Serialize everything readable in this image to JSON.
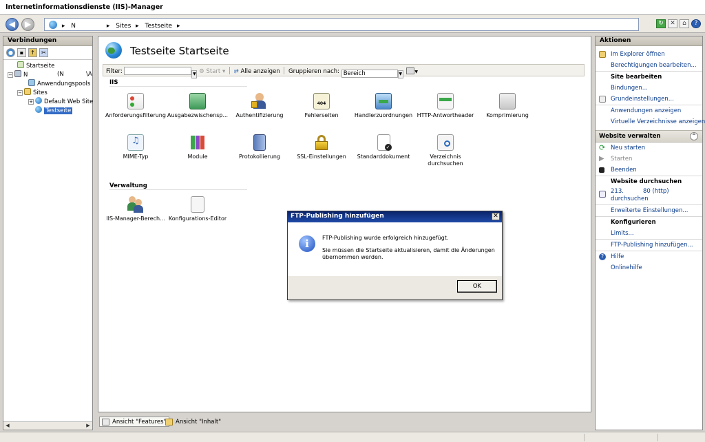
{
  "window": {
    "title": "Internetinformationsdienste (IIS)-Manager"
  },
  "address": {
    "back_icon": "back-arrow-icon",
    "forward_icon": "forward-arrow-icon",
    "segments": [
      "N",
      "Sites",
      "Testseite"
    ]
  },
  "left": {
    "header": "Verbindungen",
    "tree": [
      {
        "label": "Startseite",
        "icon": "home-icon",
        "depth": 1
      },
      {
        "label": "N",
        "label2": "(N",
        "label3": "\\A",
        "icon": "server-icon",
        "depth": 0
      },
      {
        "label": "Anwendungspools",
        "icon": "app-pools-icon",
        "depth": 2
      },
      {
        "label": "Sites",
        "icon": "folder-icon",
        "depth": 1
      },
      {
        "label": "Default Web Site",
        "icon": "site-globe-icon",
        "depth": 2
      },
      {
        "label": "Testseite",
        "icon": "site-globe-icon",
        "depth": 2,
        "selected": true
      }
    ]
  },
  "main": {
    "title": "Testseite Startseite",
    "filter": {
      "label": "Filter:",
      "start_label": "Start",
      "show_all_label": "Alle anzeigen",
      "group_label": "Gruppieren nach:",
      "group_value": "Bereich"
    },
    "groups": [
      {
        "name": "IIS"
      },
      {
        "name": "Verwaltung"
      }
    ],
    "features_iis": [
      "Anforderungsfilterung",
      "Ausgabezwischensp...",
      "Authentifizierung",
      "Fehlerseiten",
      "Handlerzuordnungen",
      "HTTP-Antwortheader",
      "Komprimierung",
      "MIME-Typ",
      "Module",
      "Protokollierung",
      "SSL-Einstellungen",
      "Standarddokument",
      "Verzeichnis durchsuchen"
    ],
    "features_verwaltung": [
      "IIS-Manager-Berech...",
      "Konfigurations-Editor"
    ],
    "fehlerseiten_badge": "404",
    "tabs": [
      {
        "label": "Ansicht \"Features\""
      },
      {
        "label": "Ansicht \"Inhalt\""
      }
    ]
  },
  "right": {
    "header": "Aktionen",
    "explore": "Im Explorer öffnen",
    "edit_perms": "Berechtigungen bearbeiten...",
    "site_edit_hdr": "Site bearbeiten",
    "bindings": "Bindungen...",
    "basic_settings": "Grundeinstellungen...",
    "view_apps": "Anwendungen anzeigen",
    "view_vdirs": "Virtuelle Verzeichnisse anzeigen",
    "manage_hdr": "Website verwalten",
    "restart": "Neu starten",
    "start": "Starten",
    "stop": "Beenden",
    "browse_hdr": "Website durchsuchen",
    "browse_line1": "213.",
    "browse_port": "80 (http)",
    "browse_line2": "durchsuchen",
    "advanced": "Erweiterte Einstellungen...",
    "configure_hdr": "Konfigurieren",
    "limits": "Limits...",
    "ftp_add": "FTP-Publishing hinzufügen...",
    "help": "Hilfe",
    "online_help": "Onlinehilfe"
  },
  "dialog": {
    "title": "FTP-Publishing hinzufügen",
    "close": "✕",
    "line1": "FTP-Publishing wurde erfolgreich hinzugefügt.",
    "line2": "Sie müssen die Startseite aktualisieren, damit die Änderungen übernommen werden.",
    "ok": "OK",
    "icon": "information-icon"
  },
  "colors": {
    "selection": "#316ac5",
    "dialog_title": "#0a246a",
    "link": "#0a3c8c"
  }
}
